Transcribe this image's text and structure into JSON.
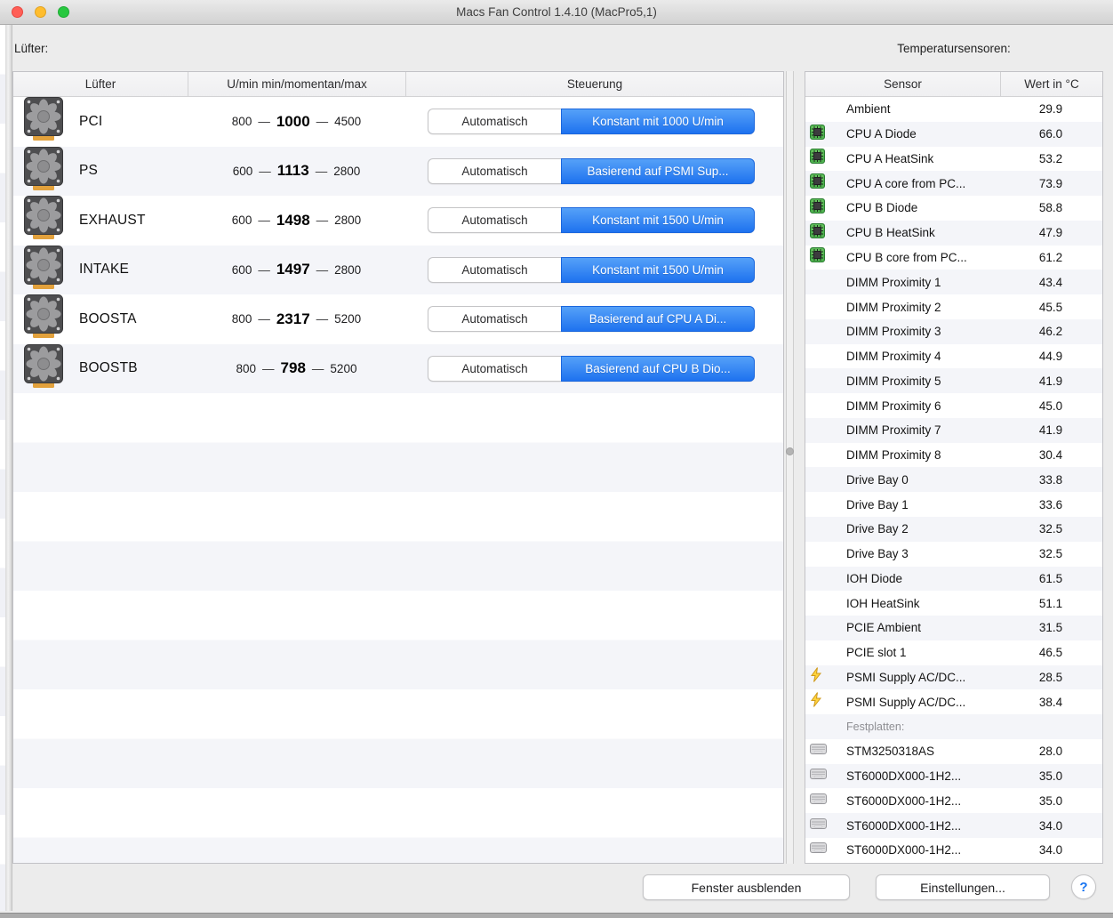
{
  "window": {
    "title": "Macs Fan Control 1.4.10 (MacPro5,1)"
  },
  "left_panel": {
    "label": "Lüfter:",
    "columns": [
      "Lüfter",
      "U/min min/momentan/max",
      "Steuerung"
    ],
    "auto_label": "Automatisch",
    "rpm_separator": "—",
    "fans": [
      {
        "name": "PCI",
        "min": "800",
        "current": "1000",
        "max": "4500",
        "mode": "Konstant mit 1000 U/min"
      },
      {
        "name": "PS",
        "min": "600",
        "current": "1113",
        "max": "2800",
        "mode": "Basierend auf PSMI Sup..."
      },
      {
        "name": "EXHAUST",
        "min": "600",
        "current": "1498",
        "max": "2800",
        "mode": "Konstant mit 1500 U/min"
      },
      {
        "name": "INTAKE",
        "min": "600",
        "current": "1497",
        "max": "2800",
        "mode": "Konstant mit 1500 U/min"
      },
      {
        "name": "BOOSTA",
        "min": "800",
        "current": "2317",
        "max": "5200",
        "mode": "Basierend auf CPU A Di..."
      },
      {
        "name": "BOOSTB",
        "min": "800",
        "current": "798",
        "max": "5200",
        "mode": "Basierend auf CPU B Dio..."
      }
    ]
  },
  "right_panel": {
    "label": "Temperatursensoren:",
    "columns": [
      "Sensor",
      "Wert in °C"
    ],
    "sensors": [
      {
        "icon": "none",
        "name": "Ambient",
        "value": "29.9"
      },
      {
        "icon": "chip",
        "name": "CPU A Diode",
        "value": "66.0"
      },
      {
        "icon": "chip",
        "name": "CPU A HeatSink",
        "value": "53.2"
      },
      {
        "icon": "chip",
        "name": "CPU A core from PC...",
        "value": "73.9"
      },
      {
        "icon": "chip",
        "name": "CPU B Diode",
        "value": "58.8"
      },
      {
        "icon": "chip",
        "name": "CPU B HeatSink",
        "value": "47.9"
      },
      {
        "icon": "chip",
        "name": "CPU B core from PC...",
        "value": "61.2"
      },
      {
        "icon": "none",
        "name": "DIMM Proximity 1",
        "value": "43.4"
      },
      {
        "icon": "none",
        "name": "DIMM Proximity 2",
        "value": "45.5"
      },
      {
        "icon": "none",
        "name": "DIMM Proximity 3",
        "value": "46.2"
      },
      {
        "icon": "none",
        "name": "DIMM Proximity 4",
        "value": "44.9"
      },
      {
        "icon": "none",
        "name": "DIMM Proximity 5",
        "value": "41.9"
      },
      {
        "icon": "none",
        "name": "DIMM Proximity 6",
        "value": "45.0"
      },
      {
        "icon": "none",
        "name": "DIMM Proximity 7",
        "value": "41.9"
      },
      {
        "icon": "none",
        "name": "DIMM Proximity 8",
        "value": "30.4"
      },
      {
        "icon": "none",
        "name": "Drive Bay 0",
        "value": "33.8"
      },
      {
        "icon": "none",
        "name": "Drive Bay 1",
        "value": "33.6"
      },
      {
        "icon": "none",
        "name": "Drive Bay 2",
        "value": "32.5"
      },
      {
        "icon": "none",
        "name": "Drive Bay 3",
        "value": "32.5"
      },
      {
        "icon": "none",
        "name": "IOH Diode",
        "value": "61.5"
      },
      {
        "icon": "none",
        "name": "IOH HeatSink",
        "value": "51.1"
      },
      {
        "icon": "none",
        "name": "PCIE Ambient",
        "value": "31.5"
      },
      {
        "icon": "none",
        "name": "PCIE slot 1",
        "value": "46.5"
      },
      {
        "icon": "lightning",
        "name": "PSMI Supply AC/DC...",
        "value": "28.5"
      },
      {
        "icon": "lightning",
        "name": "PSMI Supply AC/DC...",
        "value": "38.4"
      },
      {
        "icon": "none",
        "name": "Festplatten:",
        "value": "",
        "section": true
      },
      {
        "icon": "drive",
        "name": "STM3250318AS",
        "value": "28.0"
      },
      {
        "icon": "drive",
        "name": "ST6000DX000-1H2...",
        "value": "35.0"
      },
      {
        "icon": "drive",
        "name": "ST6000DX000-1H2...",
        "value": "35.0"
      },
      {
        "icon": "drive",
        "name": "ST6000DX000-1H2...",
        "value": "34.0"
      },
      {
        "icon": "drive",
        "name": "ST6000DX000-1H2...",
        "value": "34.0"
      }
    ]
  },
  "footer": {
    "hide_button": "Fenster ausblenden",
    "settings_button": "Einstellungen...",
    "help_button": "?"
  }
}
